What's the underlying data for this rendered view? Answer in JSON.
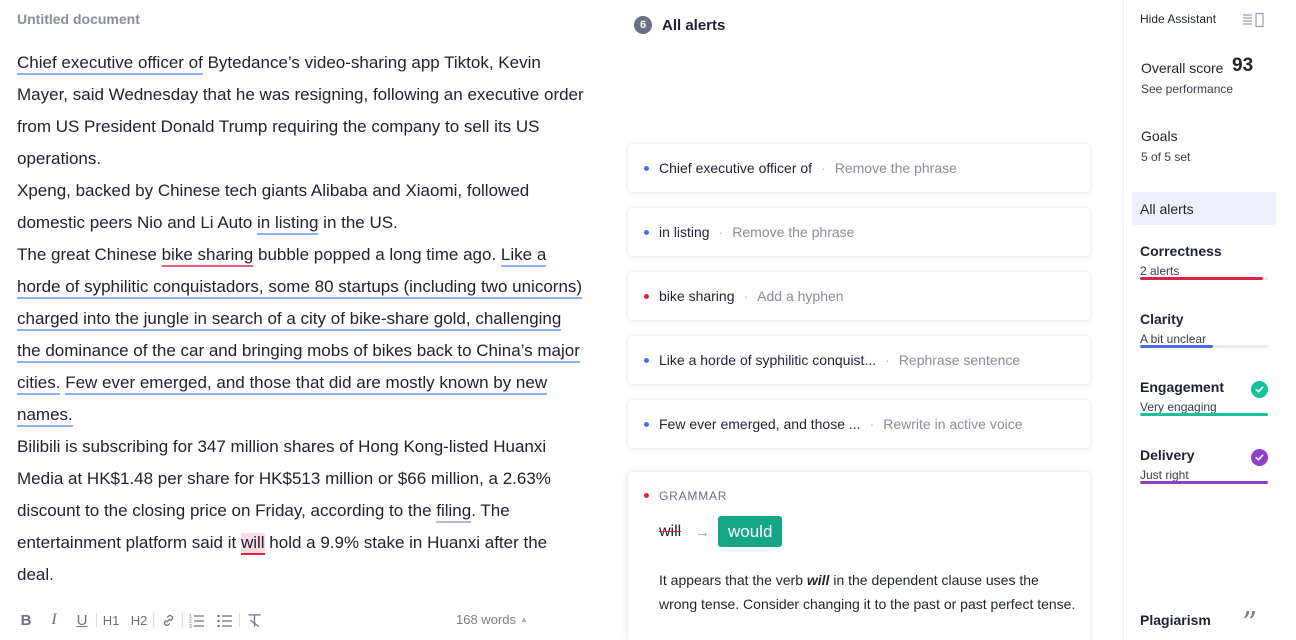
{
  "document": {
    "title": "Untitled document",
    "paragraphs": [
      [
        {
          "t": "Chief executive officer of",
          "u": "blue"
        },
        {
          "t": " Bytedance’s video-sharing app Tiktok, Kevin Mayer, said Wednesday that he was resigning, following an executive order from US President Donald Trump requiring the company to sell its US operations."
        }
      ],
      [
        {
          "t": "Xpeng, backed by Chinese tech giants Alibaba and Xiaomi, followed domestic peers Nio and Li Auto "
        },
        {
          "t": "in listing",
          "u": "blue"
        },
        {
          "t": " in the US."
        }
      ],
      [
        {
          "t": "The great Chinese "
        },
        {
          "t": "bike sharing",
          "u": "red"
        },
        {
          "t": " bubble popped a long time ago. "
        },
        {
          "t": "Like a horde of syphilitic conquistadors, some 80 startups (including two unicorns) charged into the jungle in search of a city of bike-share gold, challenging the dominance of the car and bringing mobs of bikes back to China’s major cities.",
          "u": "blue"
        },
        {
          "t": " "
        },
        {
          "t": "Few ever emerged, and those that did are mostly known by new names.",
          "u": "blue"
        }
      ],
      [
        {
          "t": "Bilibili is subscribing for 347 million shares of Hong Kong-listed Huanxi Media at HK$1.48 per share for HK$513 million or $66 million, a 2.63% discount to the closing price on Friday, according to the "
        },
        {
          "t": "filing",
          "u": "gray"
        },
        {
          "t": ". The entertainment platform said it "
        },
        {
          "t": "will",
          "u": "red-active"
        },
        {
          "t": " hold a 9.9% stake in Huanxi after the deal."
        }
      ]
    ]
  },
  "toolbar": {
    "buttons": [
      {
        "name": "bold-button",
        "label": "B",
        "icon": "bold-icon"
      },
      {
        "name": "italic-button",
        "label": "I",
        "icon": "italic-icon"
      },
      {
        "name": "underline-button",
        "label": "U",
        "icon": "underline-icon"
      },
      {
        "name": "heading1-button",
        "label": "H1",
        "icon": "heading1-icon"
      },
      {
        "name": "heading2-button",
        "label": "H2",
        "icon": "heading2-icon"
      },
      {
        "name": "link-button",
        "label": "",
        "icon": "link-icon"
      },
      {
        "name": "ordered-list-button",
        "label": "",
        "icon": "ordered-list-icon"
      },
      {
        "name": "bullet-list-button",
        "label": "",
        "icon": "bullet-list-icon"
      },
      {
        "name": "clear-format-button",
        "label": "",
        "icon": "clear-format-icon"
      }
    ],
    "word_count": "168 words"
  },
  "alerts": {
    "count": "6",
    "title": "All alerts",
    "items": [
      {
        "text": "Chief executive officer of",
        "action": "Remove the phrase",
        "color": "blue"
      },
      {
        "text": "in listing",
        "action": "Remove the phrase",
        "color": "blue"
      },
      {
        "text": "bike sharing",
        "action": "Add a hyphen",
        "color": "red"
      },
      {
        "text": "Like a horde of syphilitic conquist...",
        "action": "Rephrase sentence",
        "color": "blue"
      },
      {
        "text": "Few ever emerged, and those ...",
        "action": "Rewrite in active voice",
        "color": "blue"
      }
    ],
    "expanded": {
      "category": "GRAMMAR",
      "original": "will",
      "suggestion": "would",
      "explanation_before": "It appears that the verb ",
      "explanation_emph": "will",
      "explanation_after": " in the dependent clause uses the wrong tense. Consider changing it to the past or past perfect tense."
    }
  },
  "sidebar": {
    "hide_label": "Hide Assistant",
    "score_label": "Overall score",
    "score_value": "93",
    "see_performance": "See performance",
    "goals_label": "Goals",
    "goals_value": "5 of 5 set",
    "all_alerts_label": "All alerts",
    "categories": [
      {
        "name": "Correctness",
        "sub": "2 alerts",
        "color": "#e0213f",
        "fill": 0.96,
        "check": false
      },
      {
        "name": "Clarity",
        "sub": "A bit unclear",
        "color": "#4a6ee0",
        "fill": 0.57,
        "check": false
      },
      {
        "name": "Engagement",
        "sub": "Very engaging",
        "color": "#15c39a",
        "fill": 1.0,
        "check": true
      },
      {
        "name": "Delivery",
        "sub": "Just right",
        "color": "#8f3fc9",
        "fill": 1.0,
        "check": true
      }
    ],
    "plagiarism_label": "Plagiarism"
  },
  "colors": {
    "accent_green": "#15a687",
    "correctness_red": "#e0213f",
    "clarity_blue": "#4a6ee0"
  }
}
